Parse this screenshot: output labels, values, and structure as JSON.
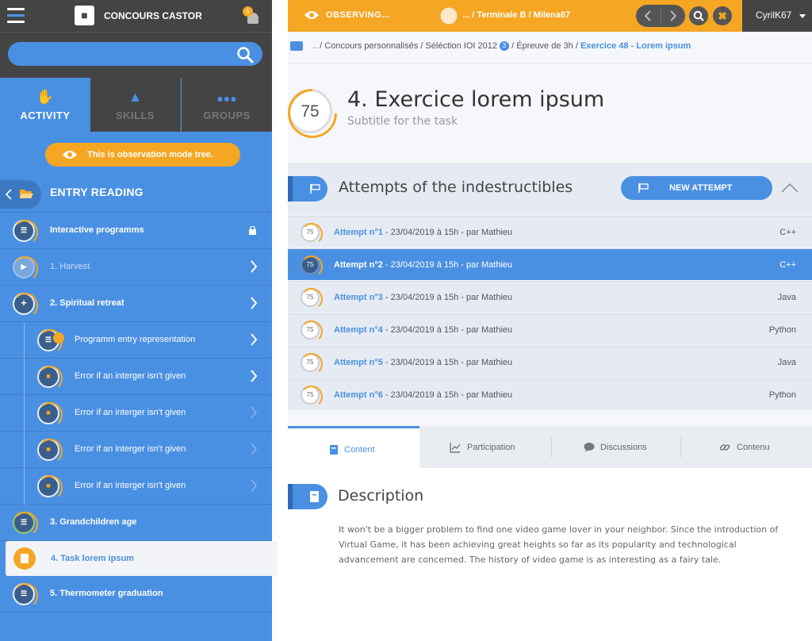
{
  "app": {
    "brand": "CONCOURS CASTOR",
    "notification_count": "5"
  },
  "search": {
    "placeholder": ""
  },
  "nav_tabs": [
    {
      "label": "ACTIVITY"
    },
    {
      "label": "SKILLS"
    },
    {
      "label": "GROUPS"
    }
  ],
  "observation_notice": "This is observation mode tree.",
  "tree": {
    "root_label": "ENTRY READING",
    "items": [
      {
        "label": "Interactive programms",
        "locked": true
      },
      {
        "label": "1. Harvest"
      },
      {
        "label": "2. Spiritual retreat"
      },
      {
        "label": "Programm entry representation"
      },
      {
        "label": "Error if an interger isn't given"
      },
      {
        "label": "Error if an interger isn't given"
      },
      {
        "label": "Error if an interger isn't given"
      },
      {
        "label": "Error if an interger isn't given"
      },
      {
        "label": "3. Grandchildren age"
      },
      {
        "label": "4. Task lorem ipsum",
        "active": true
      },
      {
        "label": "5. Thermometer graduation"
      }
    ]
  },
  "topbar": {
    "mode": "OBSERVING...",
    "crumb": "... / Terminale B / Milena67",
    "user": "CyrilK67"
  },
  "breadcrumb": {
    "prefix": ".. / Concours personnalisés / Séléction IOI 2012",
    "badge": "3",
    "middle": " / Épreuve de 3h / ",
    "current": "Exercice 48 - Lorem ipsum"
  },
  "task": {
    "score": "75",
    "title": "4. Exercice lorem ipsum",
    "subtitle": "Subtitle for the task"
  },
  "attempts": {
    "title": "Attempts of the indestructibles",
    "new_button": "NEW ATTEMPT",
    "rows": [
      {
        "score": "75",
        "name": "Attempt n°1",
        "meta": " - 23/04/2019 à 15h - par Mathieu",
        "lang": "C++"
      },
      {
        "score": "75",
        "name": "Attempt n°2",
        "meta": " - 23/04/2019 à 15h - par Mathieu",
        "lang": "C++",
        "selected": true
      },
      {
        "score": "75",
        "name": "Attempt n°3",
        "meta": " - 23/04/2019 à 15h - par Mathieu",
        "lang": "Java"
      },
      {
        "score": "75",
        "name": "Attempt n°4",
        "meta": " - 23/04/2019 à 15h - par Mathieu",
        "lang": "Python"
      },
      {
        "score": "75",
        "name": "Attempt n°5",
        "meta": " - 23/04/2019 à 15h - par Mathieu",
        "lang": "Java"
      },
      {
        "score": "75",
        "name": "Attempt n°6",
        "meta": " - 23/04/2019 à 15h - par Mathieu",
        "lang": "Python"
      }
    ]
  },
  "content_tabs": [
    {
      "label": "Content",
      "icon": "book-icon"
    },
    {
      "label": "Participation",
      "icon": "chart-icon"
    },
    {
      "label": "Discussions",
      "icon": "chat-icon"
    },
    {
      "label": "Contenu",
      "icon": "link-icon"
    }
  ],
  "description": {
    "title": "Description",
    "body": "It won't be a bigger problem to find one video game lover in your neighbor. Since the introduction of Virtual Game, it has been achieving great heights so far as its popularity and technological advancement are concerned. The history of video game is as interesting as a fairy tale."
  },
  "colors": {
    "accent": "#4a90e2",
    "warning": "#f5a623",
    "dark": "#444444"
  }
}
